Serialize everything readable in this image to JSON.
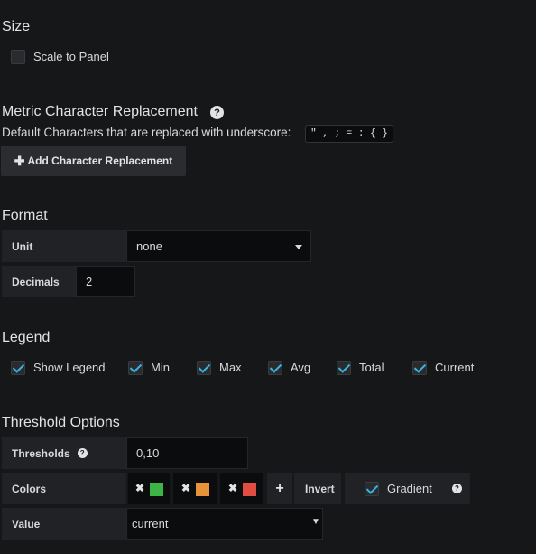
{
  "size": {
    "title": "Size",
    "scale_to_panel": {
      "label": "Scale to Panel",
      "checked": false
    }
  },
  "metric_replacement": {
    "title": "Metric Character Replacement",
    "help_icon": "question-circle-icon",
    "default_text": "Default Characters that are replaced with underscore:",
    "chars": "\" , ; = : { }",
    "add_button": "Add Character Replacement"
  },
  "format": {
    "title": "Format",
    "unit_label": "Unit",
    "unit_value": "none",
    "decimals_label": "Decimals",
    "decimals_value": "2"
  },
  "legend": {
    "title": "Legend",
    "items": [
      {
        "label": "Show Legend",
        "checked": true
      },
      {
        "label": "Min",
        "checked": true
      },
      {
        "label": "Max",
        "checked": true
      },
      {
        "label": "Avg",
        "checked": true
      },
      {
        "label": "Total",
        "checked": true
      },
      {
        "label": "Current",
        "checked": true
      }
    ]
  },
  "threshold": {
    "title": "Threshold Options",
    "thresholds_label": "Thresholds",
    "thresholds_value": "0,10",
    "colors_label": "Colors",
    "colors": [
      "#3eb446",
      "#e8923a",
      "#e24d42"
    ],
    "add_icon": "plus-icon",
    "invert_label": "Invert",
    "gradient_label": "Gradient",
    "gradient_checked": true,
    "value_label": "Value",
    "value_selected": "current"
  }
}
